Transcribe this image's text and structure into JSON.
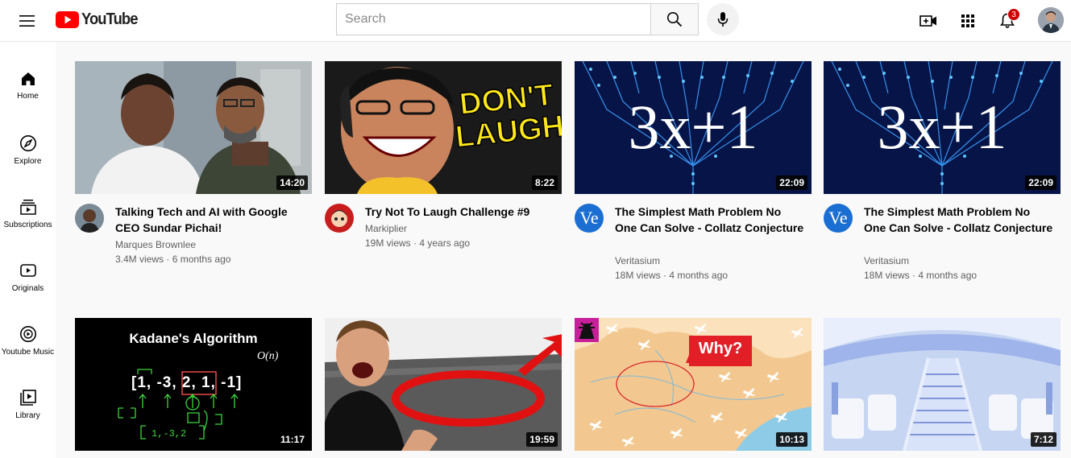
{
  "header": {
    "logo_text": "YouTube",
    "search_placeholder": "Search",
    "notification_count": "3"
  },
  "sidebar": {
    "items": [
      {
        "label": "Home",
        "icon": "home-icon"
      },
      {
        "label": "Explore",
        "icon": "compass-icon"
      },
      {
        "label": "Subscriptions",
        "icon": "subscriptions-icon"
      },
      {
        "label": "Originals",
        "icon": "originals-icon"
      },
      {
        "label": "Youtube Music",
        "icon": "music-icon"
      },
      {
        "label": "Library",
        "icon": "library-icon"
      }
    ]
  },
  "videos": [
    {
      "title": "Talking Tech and AI with Google CEO Sundar Pichai!",
      "channel": "Marques Brownlee",
      "views": "3.4M views",
      "age": "6 months ago",
      "duration": "14:20"
    },
    {
      "title": "Try Not To Laugh Challenge #9",
      "channel": "Markiplier",
      "views": "19M views",
      "age": "4 years ago",
      "duration": "8:22",
      "thumb_text": [
        "DON'T",
        "LAUGH"
      ]
    },
    {
      "title": "The Simplest Math Problem No One Can Solve - Collatz Conjecture",
      "channel": "Veritasium",
      "views": "18M views",
      "age": "4 months ago",
      "duration": "22:09",
      "thumb_text": "3x+1",
      "avatar_text": "Ve"
    },
    {
      "title": "The Simplest Math Problem No One Can Solve - Collatz Conjecture",
      "channel": "Veritasium",
      "views": "18M views",
      "age": "4 months ago",
      "duration": "22:09",
      "thumb_text": "3x+1",
      "avatar_text": "Ve"
    },
    {
      "duration": "11:17",
      "thumb_text": [
        "Kadane's Algorithm",
        "[1, -3, 2, 1, -1]",
        "O(n)"
      ]
    },
    {
      "duration": "19:59"
    },
    {
      "duration": "10:13",
      "thumb_text": "Why?"
    },
    {
      "duration": "7:12"
    }
  ]
}
